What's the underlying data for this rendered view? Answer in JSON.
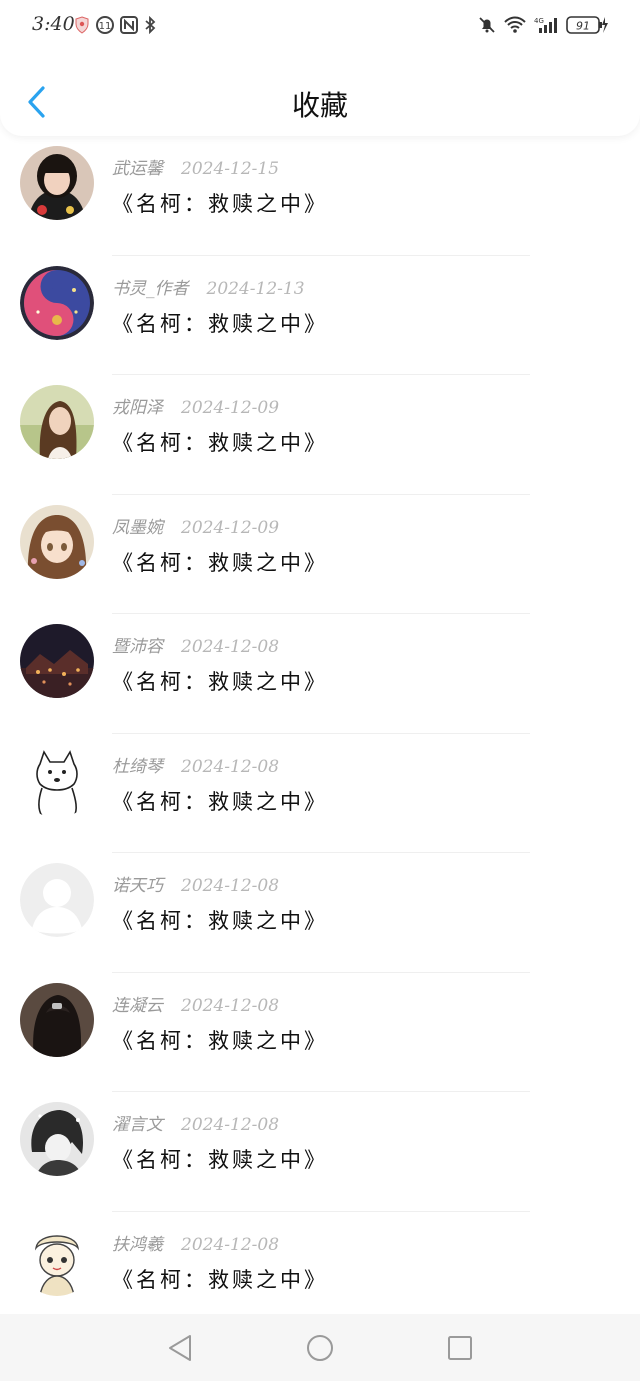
{
  "status_bar": {
    "time": "3:40",
    "battery": "91",
    "network": "4G"
  },
  "header": {
    "title": "收藏",
    "back_icon": "chevron-left-icon",
    "accent_color": "#2aa3ef"
  },
  "items": [
    {
      "author": "武运馨",
      "date": "2024-12-15",
      "title": "《名柯：救赎之中》",
      "avatar": "girl-photo"
    },
    {
      "author": "书灵_作者",
      "date": "2024-12-13",
      "title": "《名柯：救赎之中》",
      "avatar": "yin-yang-art"
    },
    {
      "author": "戎阳泽",
      "date": "2024-12-09",
      "title": "《名柯：救赎之中》",
      "avatar": "woman-photo"
    },
    {
      "author": "凤墨婉",
      "date": "2024-12-09",
      "title": "《名柯：救赎之中》",
      "avatar": "anime-girl"
    },
    {
      "author": "暨沛容",
      "date": "2024-12-08",
      "title": "《名柯：救赎之中》",
      "avatar": "night-scene"
    },
    {
      "author": "杜绮琴",
      "date": "2024-12-08",
      "title": "《名柯：救赎之中》",
      "avatar": "dog-sketch"
    },
    {
      "author": "诺天巧",
      "date": "2024-12-08",
      "title": "《名柯：救赎之中》",
      "avatar": "default-user"
    },
    {
      "author": "连凝云",
      "date": "2024-12-08",
      "title": "《名柯：救赎之中》",
      "avatar": "dark-hair"
    },
    {
      "author": "濯言文",
      "date": "2024-12-08",
      "title": "《名柯：救赎之中》",
      "avatar": "manga-boy"
    },
    {
      "author": "扶鸿羲",
      "date": "2024-12-08",
      "title": "《名柯：救赎之中》",
      "avatar": "cartoon-girl"
    }
  ],
  "bottom_nav": {
    "back": "triangle-back-icon",
    "home": "circle-home-icon",
    "recents": "square-recents-icon"
  }
}
